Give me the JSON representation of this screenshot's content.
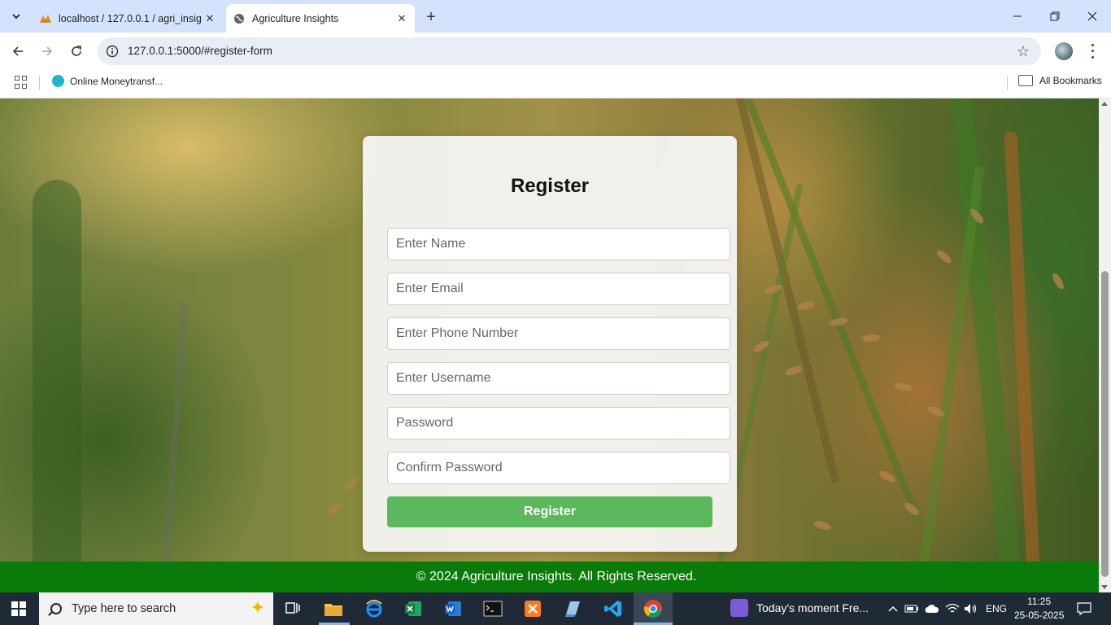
{
  "browser": {
    "tabs": [
      {
        "title": "localhost / 127.0.0.1 / agri_insig",
        "favicon": "phpmyadmin-icon",
        "active": false
      },
      {
        "title": "Agriculture Insights",
        "favicon": "globe-icon",
        "active": true
      }
    ],
    "url": "127.0.0.1:5000/#register-form",
    "bookmarks": [
      {
        "label": "Online Moneytransf..."
      }
    ],
    "all_bookmarks_label": "All Bookmarks"
  },
  "page": {
    "form": {
      "title": "Register",
      "fields": [
        {
          "placeholder": "Enter Name",
          "type": "text"
        },
        {
          "placeholder": "Enter Email",
          "type": "email"
        },
        {
          "placeholder": "Enter Phone Number",
          "type": "tel"
        },
        {
          "placeholder": "Enter Username",
          "type": "text"
        },
        {
          "placeholder": "Password",
          "type": "password"
        },
        {
          "placeholder": "Confirm Password",
          "type": "password"
        }
      ],
      "submit_label": "Register",
      "submit_color": "#5cb85c"
    },
    "footer_text": "© 2024 Agriculture Insights. All Rights Reserved.",
    "footer_color": "#0a7a0a"
  },
  "taskbar": {
    "search_placeholder": "Type here to search",
    "news_text": "Today's moment  Fre...",
    "language": "ENG",
    "time": "11:25",
    "date": "25-05-2025"
  }
}
